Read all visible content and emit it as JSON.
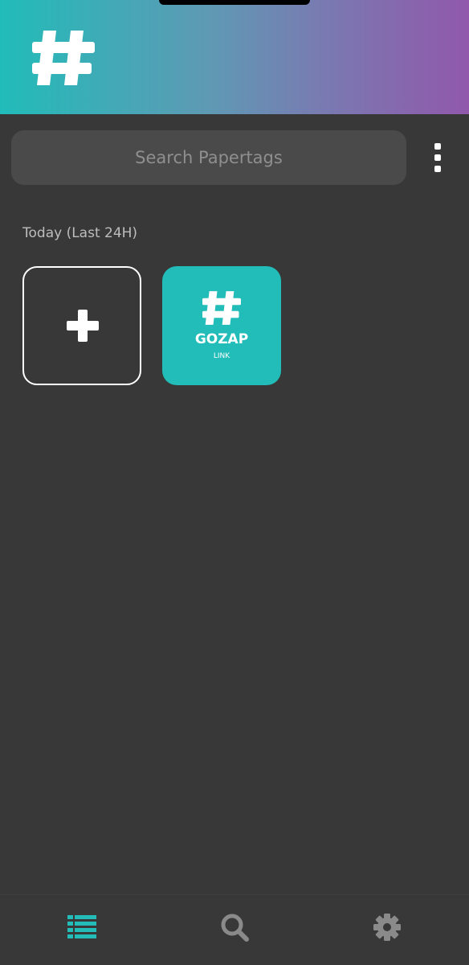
{
  "header": {
    "logo_icon": "hashtag-icon",
    "gradient_start": "#21bcb9",
    "gradient_end": "#9158ab"
  },
  "search": {
    "placeholder": "Search Papertags",
    "value": ""
  },
  "menu": {
    "icon": "kebab-menu-icon"
  },
  "section": {
    "label": "Today (Last 24H)"
  },
  "tiles": {
    "add": {
      "icon": "plus-icon"
    },
    "items": [
      {
        "icon": "hashtag-icon",
        "name": "GOZAP",
        "type": "LINK",
        "color": "#22bcb9"
      }
    ]
  },
  "bottom_nav": {
    "items": [
      {
        "icon": "list-icon",
        "active": true,
        "color": "#22bcb9"
      },
      {
        "icon": "search-icon",
        "active": false,
        "color": "#8a8a8a"
      },
      {
        "icon": "gear-icon",
        "active": false,
        "color": "#8a8a8a"
      }
    ]
  }
}
